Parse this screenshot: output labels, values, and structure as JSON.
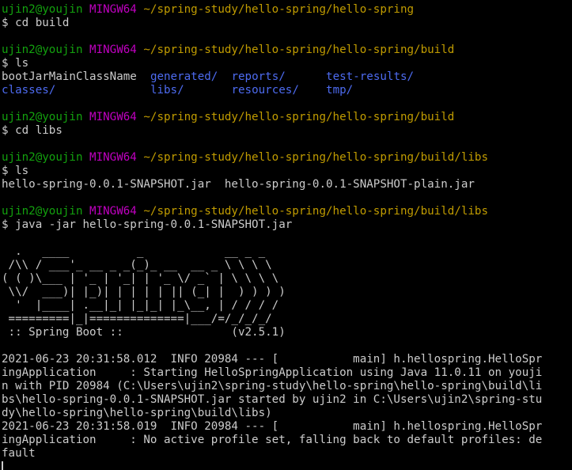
{
  "window": {
    "app": "MINGW64 terminal"
  },
  "prompt": {
    "user_host": "ujin2@youjin",
    "system": "MINGW64"
  },
  "session": [
    {
      "type": "prompt",
      "path": "~/spring-study/hello-spring/hello-spring",
      "command": "$ cd build"
    },
    {
      "type": "blank"
    },
    {
      "type": "prompt",
      "path": "~/spring-study/hello-spring/hello-spring/build",
      "command": "$ ls"
    },
    {
      "type": "ls",
      "cols": [
        {
          "text": "bootJarMainClassName",
          "dir": false
        },
        {
          "text": "generated/",
          "dir": true
        },
        {
          "text": "reports/",
          "dir": true
        },
        {
          "text": "test-results/",
          "dir": true
        }
      ]
    },
    {
      "type": "ls",
      "cols": [
        {
          "text": "classes/",
          "dir": true
        },
        {
          "text": "libs/",
          "dir": true
        },
        {
          "text": "resources/",
          "dir": true
        },
        {
          "text": "tmp/",
          "dir": true
        }
      ]
    },
    {
      "type": "blank"
    },
    {
      "type": "prompt",
      "path": "~/spring-study/hello-spring/hello-spring/build",
      "command": "$ cd libs"
    },
    {
      "type": "blank"
    },
    {
      "type": "prompt",
      "path": "~/spring-study/hello-spring/hello-spring/build/libs",
      "command": "$ ls"
    },
    {
      "type": "text",
      "text": "hello-spring-0.0.1-SNAPSHOT.jar  hello-spring-0.0.1-SNAPSHOT-plain.jar"
    },
    {
      "type": "blank"
    },
    {
      "type": "prompt",
      "path": "~/spring-study/hello-spring/hello-spring/build/libs",
      "command": "$ java -jar hello-spring-0.0.1-SNAPSHOT.jar"
    },
    {
      "type": "blank"
    },
    {
      "type": "text",
      "text": "  .   ____          _            __ _ _"
    },
    {
      "type": "text",
      "text": " /\\\\ / ___'_ __ _ _(_)_ __  __ _ \\ \\ \\ \\"
    },
    {
      "type": "text",
      "text": "( ( )\\___ | '_ | '_| | '_ \\/ _` | \\ \\ \\ \\"
    },
    {
      "type": "text",
      "text": " \\\\/  ___)| |_)| | | | | || (_| |  ) ) ) )"
    },
    {
      "type": "text",
      "text": "  '  |____| .__|_| |_|_| |_\\__, | / / / /"
    },
    {
      "type": "text",
      "text": " =========|_|==============|___/=/_/_/_/"
    },
    {
      "type": "text",
      "text": " :: Spring Boot ::                (v2.5.1)"
    },
    {
      "type": "blank"
    },
    {
      "type": "text",
      "text": "2021-06-23 20:31:58.012  INFO 20984 --- [           main] h.hellospring.HelloSpr"
    },
    {
      "type": "text",
      "text": "ingApplication     : Starting HelloSpringApplication using Java 11.0.11 on youji"
    },
    {
      "type": "text",
      "text": "n with PID 20984 (C:\\Users\\ujin2\\spring-study\\hello-spring\\hello-spring\\build\\li"
    },
    {
      "type": "text",
      "text": "bs\\hello-spring-0.0.1-SNAPSHOT.jar started by ujin2 in C:\\Users\\ujin2\\spring-stu"
    },
    {
      "type": "text",
      "text": "dy\\hello-spring\\hello-spring\\build\\libs)"
    },
    {
      "type": "text",
      "text": "2021-06-23 20:31:58.019  INFO 20984 --- [           main] h.hellospring.HelloSpr"
    },
    {
      "type": "text",
      "text": "ingApplication     : No active profile set, falling back to default profiles: de"
    },
    {
      "type": "text",
      "text": "fault"
    },
    {
      "type": "cursor"
    }
  ],
  "colors": {
    "background": "#000000",
    "foreground": "#cccccc",
    "user_host": "#13a10e",
    "system": "#c000c0",
    "path": "#c19c00",
    "directory": "#4d6bf0"
  }
}
